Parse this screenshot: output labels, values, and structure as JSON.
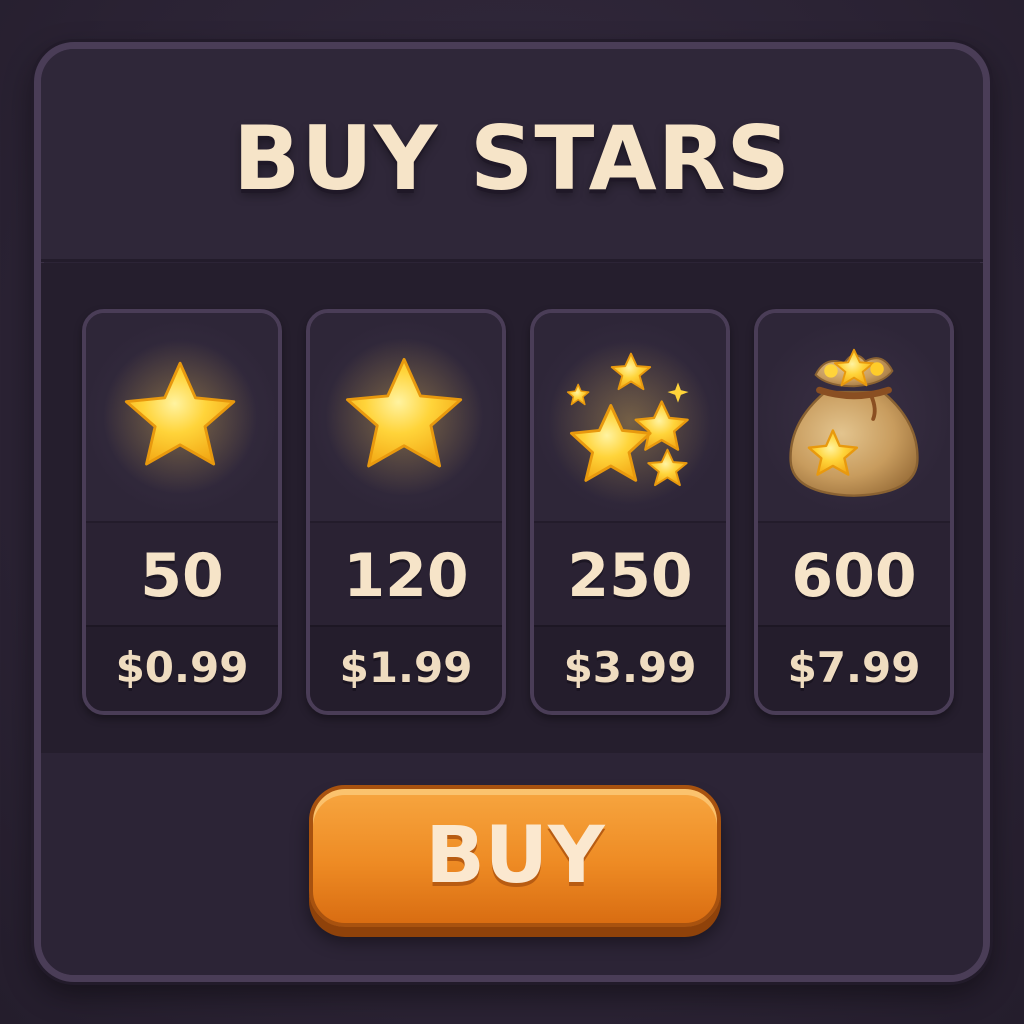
{
  "title": "BUY STARS",
  "packages": [
    {
      "amount": "50",
      "price": "$0.99",
      "icon": "star-icon"
    },
    {
      "amount": "120",
      "price": "$1.99",
      "icon": "star-icon"
    },
    {
      "amount": "250",
      "price": "$3.99",
      "icon": "star-cluster-icon"
    },
    {
      "amount": "600",
      "price": "$7.99",
      "icon": "star-bag-icon"
    }
  ],
  "buy_button": {
    "label": "BUY"
  },
  "colors": {
    "background": "#2c2436",
    "panel_border": "#4a3d57",
    "text_cream": "#f6e4c8",
    "star_yellow": "#ffd43a",
    "button_orange": "#ee8b24"
  }
}
